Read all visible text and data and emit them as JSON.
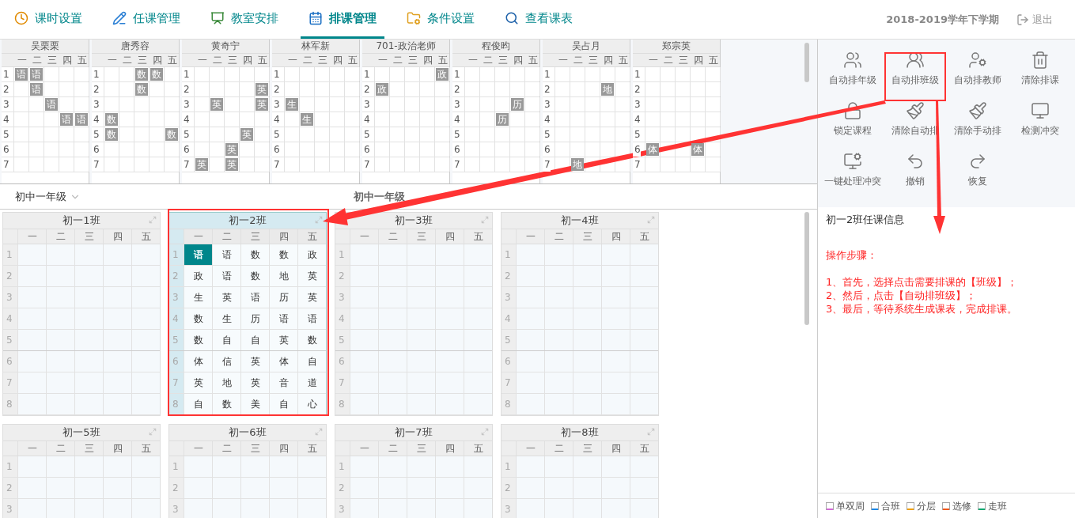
{
  "nav": {
    "tabs": [
      {
        "label": "课时设置",
        "selected": false
      },
      {
        "label": "任课管理",
        "selected": false
      },
      {
        "label": "教室安排",
        "selected": false
      },
      {
        "label": "排课管理",
        "selected": true
      },
      {
        "label": "条件设置",
        "selected": false
      },
      {
        "label": "查看课表",
        "selected": false
      }
    ],
    "term": "2018-2019学年下学期",
    "logout": "退出"
  },
  "teachers": [
    {
      "name": "吴栗栗",
      "days": [
        "一",
        "二",
        "三",
        "四",
        "五"
      ],
      "rows": [
        {
          "label": "1",
          "cells": [
            "语",
            "语",
            null,
            null,
            null
          ]
        },
        {
          "label": "2",
          "cells": [
            null,
            "语",
            null,
            null,
            null
          ]
        },
        {
          "label": "3",
          "cells": [
            null,
            null,
            "语",
            null,
            null
          ]
        },
        {
          "label": "4",
          "cells": [
            null,
            null,
            null,
            "语",
            "语"
          ]
        },
        {
          "label": "5",
          "cells": [
            null,
            null,
            null,
            null,
            null
          ]
        },
        {
          "label": "6",
          "cells": [
            null,
            null,
            null,
            null,
            null
          ]
        },
        {
          "label": "7",
          "cells": [
            null,
            null,
            null,
            null,
            null
          ]
        }
      ]
    },
    {
      "name": "唐秀容",
      "days": [
        "一",
        "二",
        "三",
        "四",
        "五"
      ],
      "rows": [
        {
          "label": "1",
          "cells": [
            null,
            null,
            "数",
            "数",
            null
          ]
        },
        {
          "label": "2",
          "cells": [
            null,
            null,
            "数",
            null,
            null
          ]
        },
        {
          "label": "3",
          "cells": [
            null,
            null,
            null,
            null,
            null
          ]
        },
        {
          "label": "4",
          "cells": [
            "数",
            null,
            null,
            null,
            null
          ]
        },
        {
          "label": "5",
          "cells": [
            "数",
            null,
            null,
            null,
            "数"
          ]
        },
        {
          "label": "6",
          "cells": [
            null,
            null,
            null,
            null,
            null
          ]
        },
        {
          "label": "7",
          "cells": [
            null,
            null,
            null,
            null,
            null
          ]
        }
      ]
    },
    {
      "name": "黄奇宁",
      "days": [
        "一",
        "二",
        "三",
        "四",
        "五"
      ],
      "rows": [
        {
          "label": "1",
          "cells": [
            null,
            null,
            null,
            null,
            null
          ]
        },
        {
          "label": "2",
          "cells": [
            null,
            null,
            null,
            null,
            "英"
          ]
        },
        {
          "label": "3",
          "cells": [
            null,
            "英",
            null,
            null,
            "英"
          ]
        },
        {
          "label": "4",
          "cells": [
            null,
            null,
            null,
            null,
            null
          ]
        },
        {
          "label": "5",
          "cells": [
            null,
            null,
            null,
            "英",
            null
          ]
        },
        {
          "label": "6",
          "cells": [
            null,
            null,
            "英",
            null,
            null
          ]
        },
        {
          "label": "7",
          "cells": [
            "英",
            null,
            "英",
            null,
            null
          ]
        }
      ]
    },
    {
      "name": "林军新",
      "days": [
        "一",
        "二",
        "三",
        "四",
        "五"
      ],
      "rows": [
        {
          "label": "1",
          "cells": [
            null,
            null,
            null,
            null,
            null
          ]
        },
        {
          "label": "2",
          "cells": [
            null,
            null,
            null,
            null,
            null
          ]
        },
        {
          "label": "3",
          "cells": [
            "生",
            null,
            null,
            null,
            null
          ]
        },
        {
          "label": "4",
          "cells": [
            null,
            "生",
            null,
            null,
            null
          ]
        },
        {
          "label": "5",
          "cells": [
            null,
            null,
            null,
            null,
            null
          ]
        },
        {
          "label": "6",
          "cells": [
            null,
            null,
            null,
            null,
            null
          ]
        },
        {
          "label": "7",
          "cells": [
            null,
            null,
            null,
            null,
            null
          ]
        }
      ]
    },
    {
      "name": "701-政治老师",
      "days": [
        "一",
        "二",
        "三",
        "四",
        "五"
      ],
      "rows": [
        {
          "label": "1",
          "cells": [
            null,
            null,
            null,
            null,
            "政"
          ]
        },
        {
          "label": "2",
          "cells": [
            "政",
            null,
            null,
            null,
            null
          ]
        },
        {
          "label": "3",
          "cells": [
            null,
            null,
            null,
            null,
            null
          ]
        },
        {
          "label": "4",
          "cells": [
            null,
            null,
            null,
            null,
            null
          ]
        },
        {
          "label": "5",
          "cells": [
            null,
            null,
            null,
            null,
            null
          ]
        },
        {
          "label": "6",
          "cells": [
            null,
            null,
            null,
            null,
            null
          ]
        },
        {
          "label": "7",
          "cells": [
            null,
            null,
            null,
            null,
            null
          ]
        }
      ]
    },
    {
      "name": "程俊昀",
      "days": [
        "一",
        "二",
        "三",
        "四",
        "五"
      ],
      "rows": [
        {
          "label": "1",
          "cells": [
            null,
            null,
            null,
            null,
            null
          ]
        },
        {
          "label": "2",
          "cells": [
            null,
            null,
            null,
            null,
            null
          ]
        },
        {
          "label": "3",
          "cells": [
            null,
            null,
            null,
            "历",
            null
          ]
        },
        {
          "label": "4",
          "cells": [
            null,
            null,
            "历",
            null,
            null
          ]
        },
        {
          "label": "5",
          "cells": [
            null,
            null,
            null,
            null,
            null
          ]
        },
        {
          "label": "6",
          "cells": [
            null,
            null,
            null,
            null,
            null
          ]
        },
        {
          "label": "7",
          "cells": [
            null,
            null,
            null,
            null,
            null
          ]
        }
      ]
    },
    {
      "name": "吴占月",
      "days": [
        "一",
        "二",
        "三",
        "四",
        "五"
      ],
      "rows": [
        {
          "label": "1",
          "cells": [
            null,
            null,
            null,
            null,
            null
          ]
        },
        {
          "label": "2",
          "cells": [
            null,
            null,
            null,
            "地",
            null
          ]
        },
        {
          "label": "3",
          "cells": [
            null,
            null,
            null,
            null,
            null
          ]
        },
        {
          "label": "4",
          "cells": [
            null,
            null,
            null,
            null,
            null
          ]
        },
        {
          "label": "5",
          "cells": [
            null,
            null,
            null,
            null,
            null
          ]
        },
        {
          "label": "6",
          "cells": [
            null,
            null,
            null,
            null,
            null
          ]
        },
        {
          "label": "7",
          "cells": [
            null,
            "地",
            null,
            null,
            null
          ]
        }
      ]
    },
    {
      "name": "郑宗英",
      "days": [
        "一",
        "二",
        "三",
        "四",
        "五"
      ],
      "rows": [
        {
          "label": "1",
          "cells": [
            null,
            null,
            null,
            null,
            null
          ]
        },
        {
          "label": "2",
          "cells": [
            null,
            null,
            null,
            null,
            null
          ]
        },
        {
          "label": "3",
          "cells": [
            null,
            null,
            null,
            null,
            null
          ]
        },
        {
          "label": "4",
          "cells": [
            null,
            null,
            null,
            null,
            null
          ]
        },
        {
          "label": "5",
          "cells": [
            null,
            null,
            null,
            null,
            null
          ]
        },
        {
          "label": "6",
          "cells": [
            "体",
            null,
            null,
            "体",
            null
          ]
        },
        {
          "label": "7",
          "cells": [
            null,
            null,
            null,
            null,
            null
          ]
        }
      ]
    }
  ],
  "grade_select": "初中一年级",
  "grade_title": "初中一年级",
  "classes": [
    {
      "name": "初一1班",
      "selected": false,
      "days": [
        "一",
        "二",
        "三",
        "四",
        "五"
      ],
      "rows": [
        {
          "label": "1",
          "cells": [
            null,
            null,
            null,
            null,
            null
          ]
        },
        {
          "label": "2",
          "cells": [
            null,
            null,
            null,
            null,
            null
          ]
        },
        {
          "label": "3",
          "cells": [
            null,
            null,
            null,
            null,
            null
          ]
        },
        {
          "label": "4",
          "cells": [
            null,
            null,
            null,
            null,
            null
          ]
        },
        {
          "label": "5",
          "cells": [
            null,
            null,
            null,
            null,
            null
          ]
        },
        {
          "label": "6",
          "cells": [
            null,
            null,
            null,
            null,
            null
          ]
        },
        {
          "label": "7",
          "cells": [
            null,
            null,
            null,
            null,
            null
          ]
        },
        {
          "label": "8",
          "cells": [
            null,
            null,
            null,
            null,
            null
          ]
        }
      ]
    },
    {
      "name": "初一2班",
      "selected": true,
      "days": [
        "一",
        "二",
        "三",
        "四",
        "五"
      ],
      "rows": [
        {
          "label": "1",
          "cells": [
            {
              "text": "语",
              "selected": true
            },
            {
              "text": "语",
              "selected": false
            },
            {
              "text": "数",
              "selected": false
            },
            {
              "text": "数",
              "selected": false
            },
            {
              "text": "政",
              "selected": false
            }
          ]
        },
        {
          "label": "2",
          "cells": [
            {
              "text": "政",
              "selected": false
            },
            {
              "text": "语",
              "selected": false
            },
            {
              "text": "数",
              "selected": false
            },
            {
              "text": "地",
              "selected": false
            },
            {
              "text": "英",
              "selected": false
            }
          ]
        },
        {
          "label": "3",
          "cells": [
            {
              "text": "生",
              "selected": false
            },
            {
              "text": "英",
              "selected": false
            },
            {
              "text": "语",
              "selected": false
            },
            {
              "text": "历",
              "selected": false
            },
            {
              "text": "英",
              "selected": false
            }
          ]
        },
        {
          "label": "4",
          "cells": [
            {
              "text": "数",
              "selected": false
            },
            {
              "text": "生",
              "selected": false
            },
            {
              "text": "历",
              "selected": false
            },
            {
              "text": "语",
              "selected": false
            },
            {
              "text": "语",
              "selected": false
            }
          ]
        },
        {
          "label": "5",
          "cells": [
            {
              "text": "数",
              "selected": false
            },
            {
              "text": "自",
              "selected": false
            },
            {
              "text": "自",
              "selected": false
            },
            {
              "text": "英",
              "selected": false
            },
            {
              "text": "数",
              "selected": false
            }
          ]
        },
        {
          "label": "6",
          "cells": [
            {
              "text": "体",
              "selected": false
            },
            {
              "text": "信",
              "selected": false
            },
            {
              "text": "英",
              "selected": false
            },
            {
              "text": "体",
              "selected": false
            },
            {
              "text": "自",
              "selected": false
            }
          ]
        },
        {
          "label": "7",
          "cells": [
            {
              "text": "英",
              "selected": false
            },
            {
              "text": "地",
              "selected": false
            },
            {
              "text": "英",
              "selected": false
            },
            {
              "text": "音",
              "selected": false
            },
            {
              "text": "道",
              "selected": false
            }
          ]
        },
        {
          "label": "8",
          "cells": [
            {
              "text": "自",
              "selected": false
            },
            {
              "text": "数",
              "selected": false
            },
            {
              "text": "美",
              "selected": false
            },
            {
              "text": "自",
              "selected": false
            },
            {
              "text": "心",
              "selected": false
            }
          ]
        }
      ]
    },
    {
      "name": "初一3班",
      "selected": false,
      "days": [
        "一",
        "二",
        "三",
        "四",
        "五"
      ],
      "rows": [
        {
          "label": "1",
          "cells": [
            null,
            null,
            null,
            null,
            null
          ]
        },
        {
          "label": "2",
          "cells": [
            null,
            null,
            null,
            null,
            null
          ]
        },
        {
          "label": "3",
          "cells": [
            null,
            null,
            null,
            null,
            null
          ]
        },
        {
          "label": "4",
          "cells": [
            null,
            null,
            null,
            null,
            null
          ]
        },
        {
          "label": "5",
          "cells": [
            null,
            null,
            null,
            null,
            null
          ]
        },
        {
          "label": "6",
          "cells": [
            null,
            null,
            null,
            null,
            null
          ]
        },
        {
          "label": "7",
          "cells": [
            null,
            null,
            null,
            null,
            null
          ]
        },
        {
          "label": "8",
          "cells": [
            null,
            null,
            null,
            null,
            null
          ]
        }
      ]
    },
    {
      "name": "初一4班",
      "selected": false,
      "days": [
        "一",
        "二",
        "三",
        "四",
        "五"
      ],
      "rows": [
        {
          "label": "1",
          "cells": [
            null,
            null,
            null,
            null,
            null
          ]
        },
        {
          "label": "2",
          "cells": [
            null,
            null,
            null,
            null,
            null
          ]
        },
        {
          "label": "3",
          "cells": [
            null,
            null,
            null,
            null,
            null
          ]
        },
        {
          "label": "4",
          "cells": [
            null,
            null,
            null,
            null,
            null
          ]
        },
        {
          "label": "5",
          "cells": [
            null,
            null,
            null,
            null,
            null
          ]
        },
        {
          "label": "6",
          "cells": [
            null,
            null,
            null,
            null,
            null
          ]
        },
        {
          "label": "7",
          "cells": [
            null,
            null,
            null,
            null,
            null
          ]
        },
        {
          "label": "8",
          "cells": [
            null,
            null,
            null,
            null,
            null
          ]
        }
      ]
    },
    {
      "name": "初一5班",
      "selected": false,
      "days": [
        "一",
        "二",
        "三",
        "四",
        "五"
      ],
      "rows": [
        {
          "label": "1",
          "cells": [
            null,
            null,
            null,
            null,
            null
          ]
        },
        {
          "label": "2",
          "cells": [
            null,
            null,
            null,
            null,
            null
          ]
        },
        {
          "label": "3",
          "cells": [
            null,
            null,
            null,
            null,
            null
          ]
        }
      ]
    },
    {
      "name": "初一6班",
      "selected": false,
      "days": [
        "一",
        "二",
        "三",
        "四",
        "五"
      ],
      "rows": [
        {
          "label": "1",
          "cells": [
            null,
            null,
            null,
            null,
            null
          ]
        },
        {
          "label": "2",
          "cells": [
            null,
            null,
            null,
            null,
            null
          ]
        },
        {
          "label": "3",
          "cells": [
            null,
            null,
            null,
            null,
            null
          ]
        }
      ]
    },
    {
      "name": "初一7班",
      "selected": false,
      "days": [
        "一",
        "二",
        "三",
        "四",
        "五"
      ],
      "rows": [
        {
          "label": "1",
          "cells": [
            null,
            null,
            null,
            null,
            null
          ]
        },
        {
          "label": "2",
          "cells": [
            null,
            null,
            null,
            null,
            null
          ]
        },
        {
          "label": "3",
          "cells": [
            null,
            null,
            null,
            null,
            null
          ]
        }
      ]
    },
    {
      "name": "初一8班",
      "selected": false,
      "days": [
        "一",
        "二",
        "三",
        "四",
        "五"
      ],
      "rows": [
        {
          "label": "1",
          "cells": [
            null,
            null,
            null,
            null,
            null
          ]
        },
        {
          "label": "2",
          "cells": [
            null,
            null,
            null,
            null,
            null
          ]
        },
        {
          "label": "3",
          "cells": [
            null,
            null,
            null,
            null,
            null
          ]
        }
      ]
    }
  ],
  "tools": [
    "自动排年级",
    "自动排班级",
    "自动排教师",
    "清除排课",
    "锁定课程",
    "清除自动排",
    "清除手动排",
    "检测冲突",
    "一键处理冲突",
    "撤销",
    "恢复"
  ],
  "info_title": "初一2班任课信息",
  "steps": [
    "操作步骤：",
    "1、首先，选择点击需要排课的【班级】；",
    "2、然后，点击【自动排班级】；",
    "3、最后，等待系统生成课表，完成排课。"
  ],
  "legend": [
    {
      "label": "单双周",
      "color": "#d36ad6"
    },
    {
      "label": "合班",
      "color": "#1e88e5"
    },
    {
      "label": "分层",
      "color": "#f0a000"
    },
    {
      "label": "选修",
      "color": "#f05a1e"
    },
    {
      "label": "走班",
      "color": "#00a870"
    }
  ]
}
